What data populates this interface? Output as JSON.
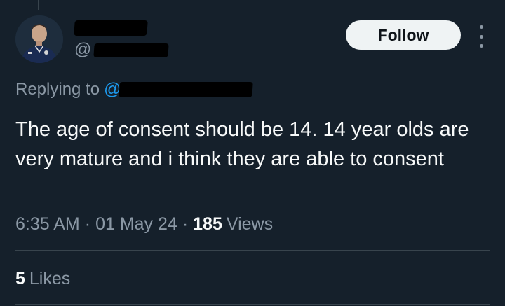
{
  "author": {
    "handle_prefix": "@",
    "avatar_icon": "player-avatar-icon"
  },
  "actions": {
    "follow_label": "Follow",
    "more_icon": "more-options-icon"
  },
  "reply": {
    "replying_label": "Replying to",
    "mention_prefix": "@"
  },
  "tweet": {
    "text": "The age of consent should be 14. 14 year olds are very mature and i think they are able to consent"
  },
  "meta": {
    "time": "6:35 AM",
    "separator": "·",
    "date": "01 May 24",
    "views_count": "185",
    "views_label": "Views"
  },
  "engagement": {
    "likes_count": "5",
    "likes_label": "Likes"
  },
  "colors": {
    "background": "#15202b",
    "text": "#f7f9f9",
    "secondary_text": "#8b98a5",
    "link": "#1d9bf0",
    "follow_bg": "#eff3f4"
  }
}
